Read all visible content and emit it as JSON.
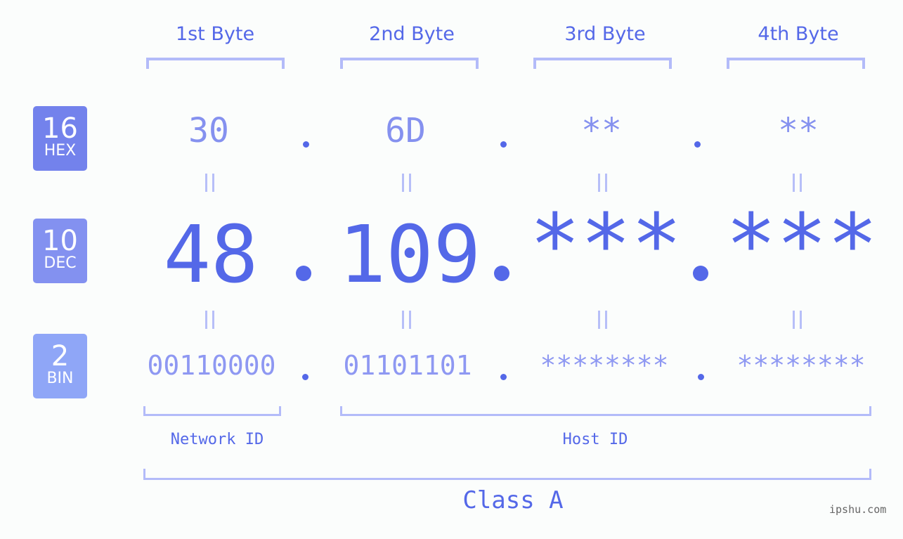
{
  "bytes": [
    {
      "header": "1st Byte",
      "hex": "30",
      "dec": "48",
      "bin": "00110000"
    },
    {
      "header": "2nd Byte",
      "hex": "6D",
      "dec": "109",
      "bin": "01101101"
    },
    {
      "header": "3rd Byte",
      "hex": "**",
      "dec": "***",
      "bin": "********"
    },
    {
      "header": "4th Byte",
      "hex": "**",
      "dec": "***",
      "bin": "********"
    }
  ],
  "badges": {
    "hex": {
      "num": "16",
      "label": "HEX",
      "color": "#7382ec"
    },
    "dec": {
      "num": "10",
      "label": "DEC",
      "color": "#8391f0"
    },
    "bin": {
      "num": "2",
      "label": "BIN",
      "color": "#8fa6f7"
    }
  },
  "labels": {
    "network": "Network ID",
    "host": "Host ID",
    "class": "Class A"
  },
  "watermark": "ipshu.com",
  "colors": {
    "accent": "#5468e8",
    "bracket": "#b3bbf9"
  }
}
